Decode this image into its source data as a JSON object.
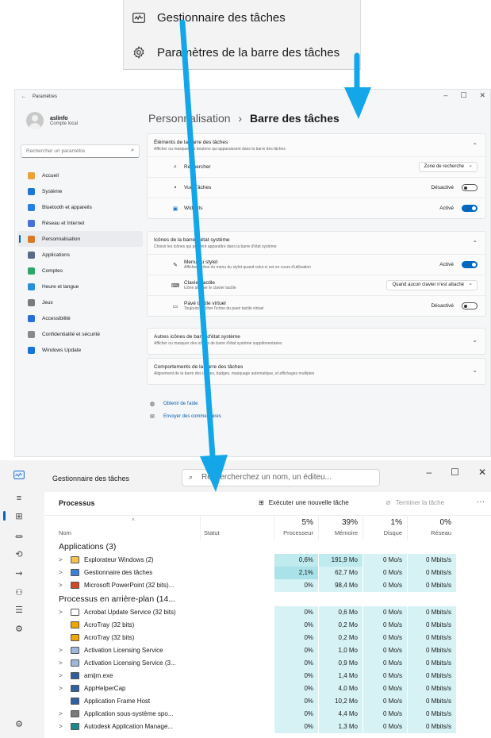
{
  "context_menu": {
    "items": [
      {
        "label": "Gestionnaire des tâches",
        "icon": "task-manager-icon"
      },
      {
        "label": "Paramètres de la barre des tâches",
        "icon": "gear-icon"
      }
    ]
  },
  "settings": {
    "window_title": "Paramètres",
    "user": {
      "name": "aslinfo",
      "type": "Compte local"
    },
    "search_placeholder": "Rechercher un paramètre",
    "nav": [
      {
        "label": "Accueil",
        "color": "#e8a33d"
      },
      {
        "label": "Système",
        "color": "#1f75d1"
      },
      {
        "label": "Bluetooth et appareils",
        "color": "#2a7de1"
      },
      {
        "label": "Réseau et Internet",
        "color": "#4a6fd8"
      },
      {
        "label": "Personnalisation",
        "color": "#d67a2c",
        "active": true
      },
      {
        "label": "Applications",
        "color": "#5b6b85"
      },
      {
        "label": "Comptes",
        "color": "#31a46b"
      },
      {
        "label": "Heure et langue",
        "color": "#2b8fd6"
      },
      {
        "label": "Jeux",
        "color": "#7a7a7a"
      },
      {
        "label": "Accessibilité",
        "color": "#2b6ed6"
      },
      {
        "label": "Confidentialité et sécurité",
        "color": "#8a8a8a"
      },
      {
        "label": "Windows Update",
        "color": "#1a73d9"
      }
    ],
    "breadcrumb": {
      "parent": "Personnalisation",
      "separator": "›",
      "current": "Barre des tâches"
    },
    "cards": {
      "taskbar_items": {
        "title": "Éléments de la barre des tâches",
        "subtitle": "Afficher ou masquer les boutons qui apparaissent dans la barre des tâches",
        "rows": [
          {
            "label": "Rechercher",
            "value": "Zone de recherche"
          },
          {
            "label": "Vue Tâches",
            "value": "Désactivé",
            "toggle": "off"
          },
          {
            "label": "Widgets",
            "value": "Activé",
            "toggle": "on"
          }
        ]
      },
      "system_tray": {
        "title": "Icônes de la barre d'état système",
        "subtitle": "Choisir les icônes qui peuvent apparaître dans la barre d'état système",
        "rows": [
          {
            "label": "Menu du stylet",
            "sub": "Afficher l'icône du menu du stylet quand celui-ci est en cours d'utilisation",
            "value": "Activé",
            "toggle": "on"
          },
          {
            "label": "Clavier tactile",
            "sub": "Icône afficher le clavier tactile",
            "value": "Quand aucun clavier n'est attaché"
          },
          {
            "label": "Pavé tactile virtuel",
            "sub": "Toujours afficher l'icône du pavé tactile virtuel",
            "value": "Désactivé",
            "toggle": "off"
          }
        ]
      },
      "other_icons": {
        "title": "Autres icônes de barre d'état système",
        "subtitle": "Afficher ou masquer des icônes de barre d'état système supplémentaires"
      },
      "behaviors": {
        "title": "Comportements de la barre des tâches",
        "subtitle": "Alignement de la barre des tâches, badges, masquage automatique, et affichages multiples"
      }
    },
    "help_links": [
      "Obtenir de l'aide",
      "Envoyer des commentaires"
    ]
  },
  "task_manager": {
    "title": "Gestionnaire des tâches",
    "search_placeholder": "Rechercherchez un nom, un éditeu...",
    "section": "Processus",
    "run_task": "Exécuter une nouvelle tâche",
    "end_task": "Terminer la tâche",
    "more": "···",
    "columns": {
      "name": "Nom",
      "status": "Statut",
      "cpu": {
        "pct": "5%",
        "label": "Processeur"
      },
      "mem": {
        "pct": "39%",
        "label": "Mémoire"
      },
      "disk": {
        "pct": "1%",
        "label": "Disque"
      },
      "net": {
        "pct": "0%",
        "label": "Réseau"
      }
    },
    "groups": [
      {
        "title": "Applications (3)",
        "rows": [
          {
            "name": "Explorateur Windows (2)",
            "cpu": "0,6%",
            "mem": "191,9 Mo",
            "disk": "0 Mo/s",
            "net": "0 Mbits/s",
            "expand": true,
            "icon_color": "#f2c34a"
          },
          {
            "name": "Gestionnaire des tâches",
            "cpu": "2,1%",
            "mem": "62,7 Mo",
            "disk": "0 Mo/s",
            "net": "0 Mbits/s",
            "expand": true,
            "icon_color": "#3b82d6"
          },
          {
            "name": "Microsoft PowerPoint (32 bits)...",
            "cpu": "0%",
            "mem": "98,4 Mo",
            "disk": "0 Mo/s",
            "net": "0 Mbits/s",
            "expand": true,
            "icon_color": "#d24726"
          }
        ]
      },
      {
        "title": "Processus en arrière-plan (14...",
        "rows": [
          {
            "name": "Acrobat Update Service (32 bits)",
            "cpu": "0%",
            "mem": "0,6 Mo",
            "disk": "0 Mo/s",
            "net": "0 Mbits/s",
            "expand": true,
            "icon_color": "#ffffff"
          },
          {
            "name": "AcroTray (32 bits)",
            "cpu": "0%",
            "mem": "0,2 Mo",
            "disk": "0 Mo/s",
            "net": "0 Mbits/s",
            "expand": false,
            "icon_color": "#f0a500"
          },
          {
            "name": "AcroTray (32 bits)",
            "cpu": "0%",
            "mem": "0,2 Mo",
            "disk": "0 Mo/s",
            "net": "0 Mbits/s",
            "expand": false,
            "icon_color": "#f0a500"
          },
          {
            "name": "Activation Licensing Service",
            "cpu": "0%",
            "mem": "1,0 Mo",
            "disk": "0 Mo/s",
            "net": "0 Mbits/s",
            "expand": true,
            "icon_color": "#9fb7d8"
          },
          {
            "name": "Activation Licensing Service (3...",
            "cpu": "0%",
            "mem": "0,9 Mo",
            "disk": "0 Mo/s",
            "net": "0 Mbits/s",
            "expand": true,
            "icon_color": "#9fb7d8"
          },
          {
            "name": "amijm.exe",
            "cpu": "0%",
            "mem": "1,4 Mo",
            "disk": "0 Mo/s",
            "net": "0 Mbits/s",
            "expand": true,
            "icon_color": "#2f5f9e"
          },
          {
            "name": "AppHelperCap",
            "cpu": "0%",
            "mem": "4,0 Mo",
            "disk": "0 Mo/s",
            "net": "0 Mbits/s",
            "expand": true,
            "icon_color": "#2f5f9e"
          },
          {
            "name": "Application Frame Host",
            "cpu": "0%",
            "mem": "10,2 Mo",
            "disk": "0 Mo/s",
            "net": "0 Mbits/s",
            "expand": false,
            "icon_color": "#2f5f9e"
          },
          {
            "name": "Application sous-système spo...",
            "cpu": "0%",
            "mem": "4,4 Mo",
            "disk": "0 Mo/s",
            "net": "0 Mbits/s",
            "expand": true,
            "icon_color": "#7a7a7a"
          },
          {
            "name": "Autodesk Application Manage...",
            "cpu": "0%",
            "mem": "1,3 Mo",
            "disk": "0 Mo/s",
            "net": "0 Mbits/s",
            "expand": true,
            "icon_color": "#1b8a8a"
          }
        ]
      }
    ]
  },
  "arrow_color": "#13a6e8"
}
